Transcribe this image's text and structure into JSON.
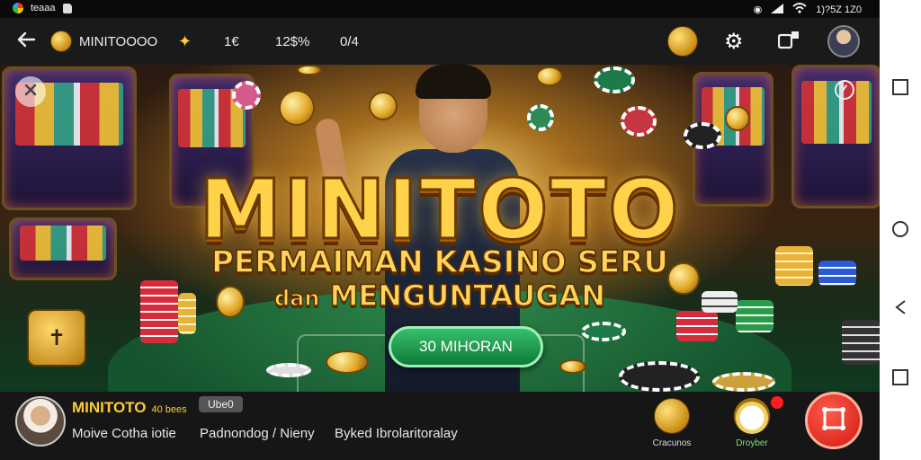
{
  "status_bar": {
    "app_name": "teaaa",
    "time": "1)?5Z 1Z0",
    "icons": [
      "app-icon",
      "sim-icon",
      "silent-icon",
      "signal-icon",
      "wifi-icon",
      "battery-icon"
    ]
  },
  "app_bar": {
    "title": "MINITOOOO",
    "items": [
      "1€",
      "12$%",
      "0/4"
    ],
    "icons": [
      "back-icon",
      "logo-coin-icon",
      "gift-icon",
      "coin-bag-icon",
      "settings-icon",
      "share-icon",
      "user-avatar"
    ]
  },
  "banner": {
    "title": "MINITOTO",
    "subtitle_line1": "PERMAIMAN KASINO SERU",
    "subtitle_line2_prefix": "dan",
    "subtitle_line2_main": "MENGUNTAUGAN",
    "cta_label": "30 MIHORAN"
  },
  "bottom_bar": {
    "brand_name": "MINITOTO",
    "brand_badge": "40 bees",
    "tag": "Ube0",
    "links": [
      "Moive Cotha iotie",
      "Padnondog / Nieny",
      "Byked Ibrolaritoralay"
    ],
    "shortcut_1_label": "Cracunos",
    "shortcut_2_label": "Droyber"
  },
  "colors": {
    "accent_gold": "#ffd24a",
    "cta_green": "#1fa356",
    "fab_red": "#e3241a"
  }
}
